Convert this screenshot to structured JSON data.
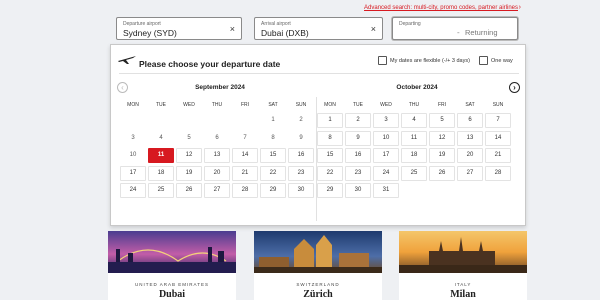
{
  "search": {
    "advanced_link": "Advanced search: multi-city, promo codes, partner airlines",
    "advanced_chevron": "›",
    "departure": {
      "label": "Departure airport",
      "value": "Sydney (SYD)",
      "clear": "×"
    },
    "arrival": {
      "label": "Arrival airport",
      "value": "Dubai (DXB)",
      "clear": "×"
    },
    "dates": {
      "label": "Departing",
      "separator": "-",
      "returning": "Returning"
    }
  },
  "calendar": {
    "title": "Please choose your departure date",
    "flexible_label": "My dates are flexible (-/+ 3 days)",
    "one_way_label": "One way",
    "prev_icon": "‹",
    "next_icon": "›",
    "weekdays": [
      "MON",
      "TUE",
      "WED",
      "THU",
      "FRI",
      "SAT",
      "SUN"
    ],
    "months": [
      {
        "name": "September 2024",
        "first_weekday": 6,
        "days": 30,
        "selected": 11,
        "past_until": 10
      },
      {
        "name": "October 2024",
        "first_weekday": 1,
        "days": 31,
        "selected": null,
        "past_until": 0
      }
    ]
  },
  "destinations": [
    {
      "country": "UNITED ARAB EMIRATES",
      "city": "Dubai"
    },
    {
      "country": "SWITZERLAND",
      "city": "Zürich"
    },
    {
      "country": "ITALY",
      "city": "Milan"
    }
  ],
  "colors": {
    "accent": "#d71920",
    "border": "#8a8a8a"
  }
}
